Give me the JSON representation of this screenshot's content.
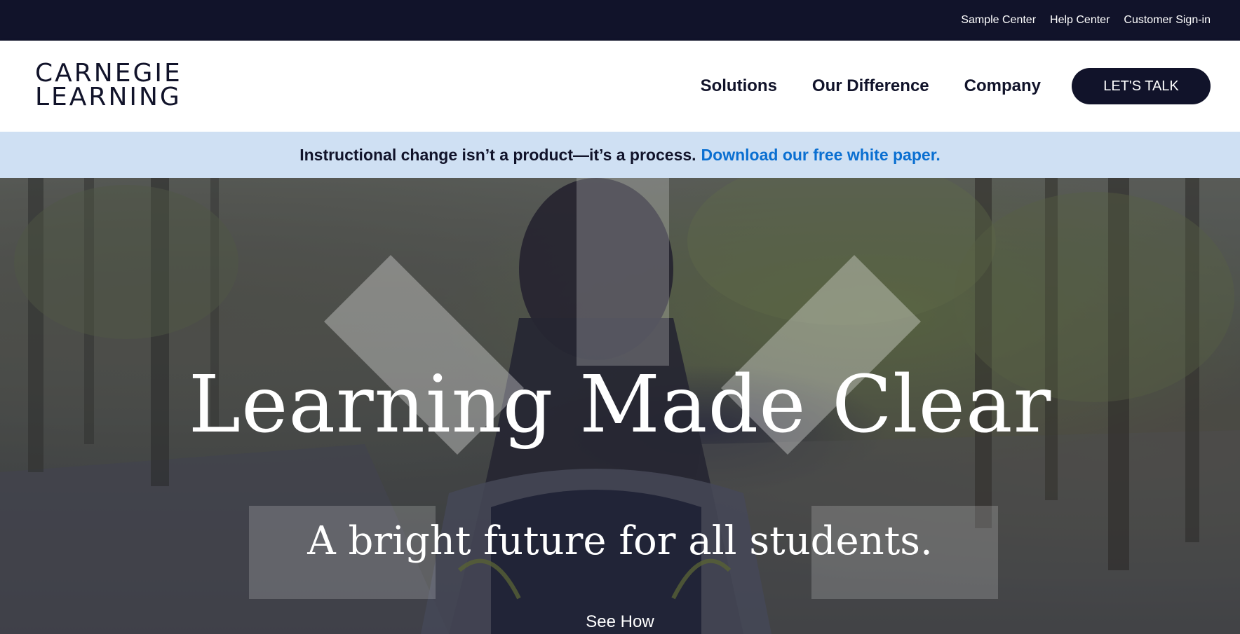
{
  "utility_nav": {
    "links": [
      "Sample Center",
      "Help Center",
      "Customer Sign-in"
    ]
  },
  "header": {
    "logo_line1": "CARNEGIE",
    "logo_line2": "LEARNING",
    "nav": [
      "Solutions",
      "Our Difference",
      "Company"
    ],
    "cta_label": "LET'S TALK"
  },
  "announcement": {
    "text": "Instructional change isn’t a product—it’s a process.",
    "link_text": "Download our free white paper."
  },
  "hero": {
    "title": "Learning Made Clear",
    "subtitle": "A bright future for all students.",
    "see_how": "See How"
  },
  "colors": {
    "navy": "#11132a",
    "announcement_bg": "#cfe0f3",
    "link_blue": "#0a6fd1",
    "white": "#ffffff"
  }
}
